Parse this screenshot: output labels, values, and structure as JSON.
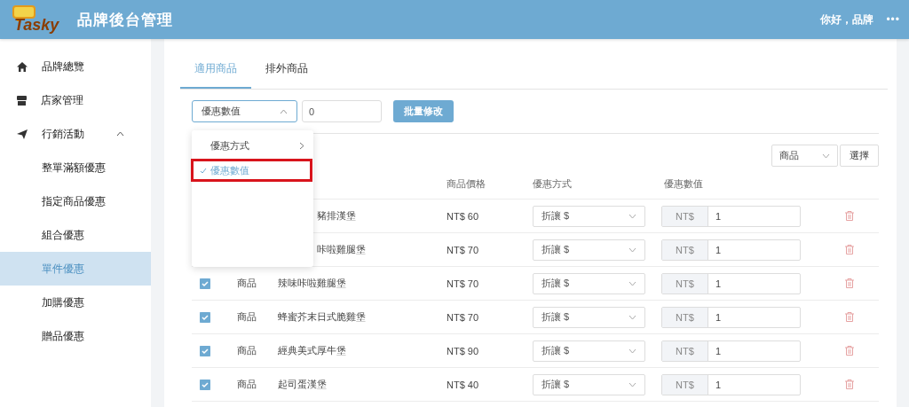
{
  "header": {
    "logo": "Tasky",
    "title": "品牌後台管理",
    "greeting": "你好，品牌",
    "more": "•••"
  },
  "sidebar": {
    "items": [
      {
        "label": "品牌總覽",
        "selected": false
      },
      {
        "label": "店家管理",
        "selected": false
      },
      {
        "label": "行銷活動",
        "selected": false,
        "expanded": true,
        "children": [
          {
            "label": "整單滿額優惠",
            "selected": false
          },
          {
            "label": "指定商品優惠",
            "selected": false
          },
          {
            "label": "組合優惠",
            "selected": false
          },
          {
            "label": "單件優惠",
            "selected": true
          },
          {
            "label": "加購優惠",
            "selected": false
          },
          {
            "label": "贈品優惠",
            "selected": false
          }
        ]
      }
    ]
  },
  "tabs": [
    {
      "label": "適用商品",
      "selected": true
    },
    {
      "label": "排外商品",
      "selected": false
    }
  ],
  "toolbar": {
    "field_select": {
      "value": "優惠數值",
      "open": true
    },
    "value_input": {
      "value": "0"
    },
    "button": "批量修改"
  },
  "dropdown": {
    "items": [
      {
        "label": "優惠方式",
        "has_submenu": true,
        "selected": false,
        "annotated": false
      },
      {
        "label": "優惠數值",
        "has_submenu": false,
        "selected": true,
        "annotated": true
      }
    ]
  },
  "filter": {
    "select": "商品",
    "button": "選擇"
  },
  "table": {
    "columns": [
      "商品價格",
      "優惠方式",
      "優惠數值"
    ],
    "rows": [
      {
        "name": "豬排漢堡",
        "price": "NT$ 60",
        "method": "折讓 $",
        "prefix": "NT$",
        "value": "1"
      },
      {
        "name": "咔啦雞腿堡",
        "price": "NT$ 70",
        "method": "折讓 $",
        "prefix": "NT$",
        "value": "1"
      },
      {
        "checked": true,
        "type": "商品",
        "name": "辣味咔啦雞腿堡",
        "price": "NT$ 70",
        "method": "折讓 $",
        "prefix": "NT$",
        "value": "1"
      },
      {
        "checked": true,
        "type": "商品",
        "name": "蜂蜜芥末日式脆雞堡",
        "price": "NT$ 70",
        "method": "折讓 $",
        "prefix": "NT$",
        "value": "1"
      },
      {
        "checked": true,
        "type": "商品",
        "name": "經典美式厚牛堡",
        "price": "NT$ 90",
        "method": "折讓 $",
        "prefix": "NT$",
        "value": "1"
      },
      {
        "checked": true,
        "type": "商品",
        "name": "起司蛋漢堡",
        "price": "NT$ 40",
        "method": "折讓 $",
        "prefix": "NT$",
        "value": "1"
      }
    ]
  }
}
